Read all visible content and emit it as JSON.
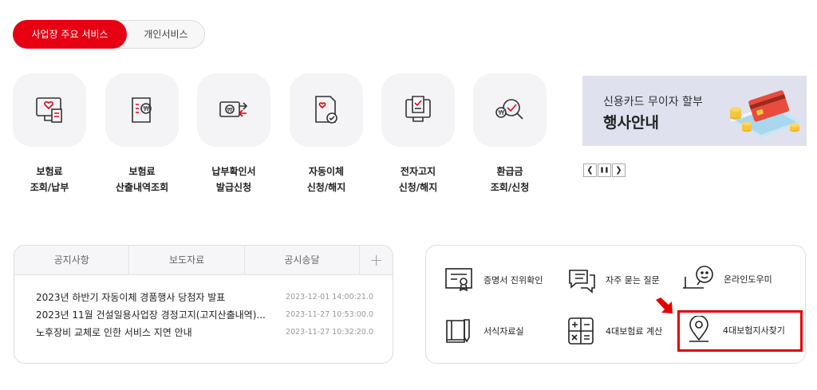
{
  "service_toggle": {
    "business": "사업장 주요 서비스",
    "personal": "개인서비스"
  },
  "quick_menu": [
    {
      "line1": "보험료",
      "line2": "조회/납부",
      "icon": "invoice-monitor-icon"
    },
    {
      "line1": "보험료",
      "line2": "산출내역조회",
      "icon": "document-won-icon"
    },
    {
      "line1": "납부확인서",
      "line2": "발급신청",
      "icon": "payment-transfer-icon"
    },
    {
      "line1": "자동이체",
      "line2": "신청/해지",
      "icon": "auto-transfer-doc-icon"
    },
    {
      "line1": "전자고지",
      "line2": "신청/해지",
      "icon": "e-notice-monitor-icon"
    },
    {
      "line1": "환급금",
      "line2": "조회/신청",
      "icon": "refund-search-icon"
    }
  ],
  "banner": {
    "line1": "신용카드 무이자 할부",
    "line2": "행사안내",
    "controls": [
      "❮",
      "❚❚",
      "❯"
    ]
  },
  "notice": {
    "tabs": [
      "공지사항",
      "보도자료",
      "공시송달",
      "+"
    ],
    "items": [
      {
        "title": "2023년 하반기 자동이체 경품행사 당첨자 발표",
        "date": "2023-12-01 14:00:21.0"
      },
      {
        "title": "2023년 11월 건설일용사업장 경정고지(고지산출내역)...",
        "date": "2023-11-27 10:53:00.0"
      },
      {
        "title": "노후장비 교체로 인한 서비스 지연 안내",
        "date": "2023-11-27 10:32:20.0"
      }
    ]
  },
  "quick_links": [
    {
      "label": "증명서 진위확인",
      "icon": "certificate-icon"
    },
    {
      "label": "자주 묻는 질문",
      "icon": "chat-bubble-icon"
    },
    {
      "label": "온라인도우미",
      "icon": "online-helper-icon"
    },
    {
      "label": "서식자료실",
      "icon": "book-pencil-icon"
    },
    {
      "label": "4대보험료 계산",
      "icon": "calculator-icon"
    },
    {
      "label": "4대보험지사찾기",
      "icon": "location-pin-icon"
    }
  ],
  "colors": {
    "accent": "#e60012",
    "highlight": "#e30000"
  }
}
